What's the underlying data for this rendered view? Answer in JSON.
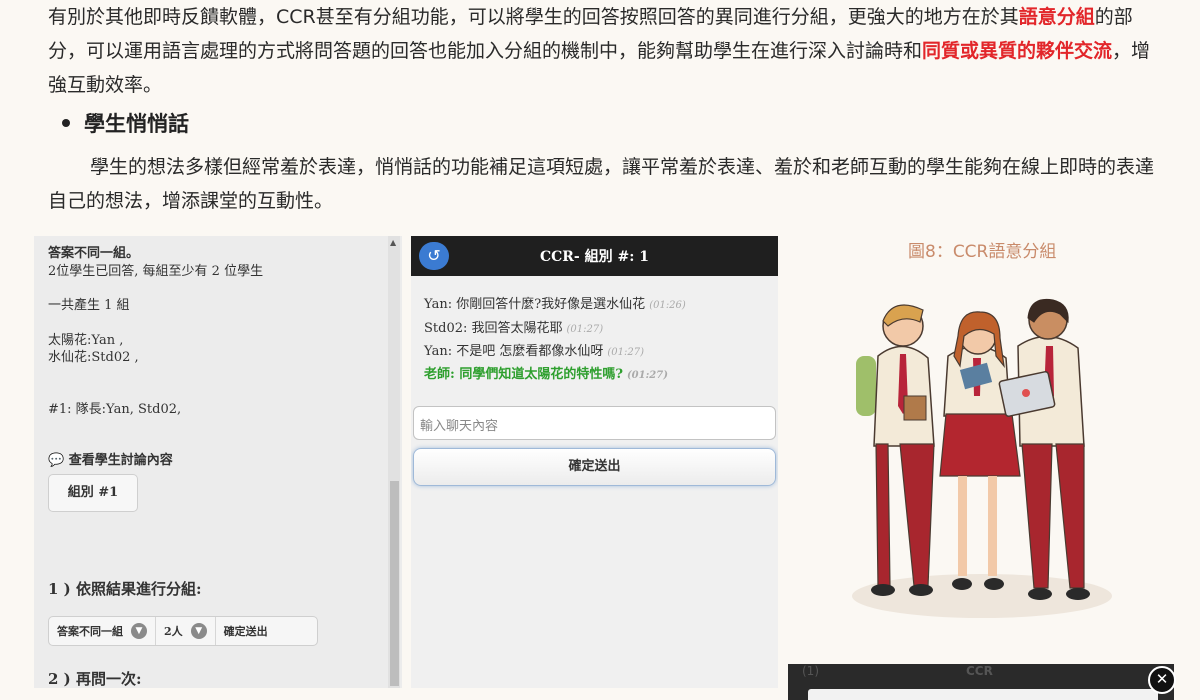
{
  "article": {
    "p1_a": "有別於其他即時反饋軟體，CCR甚至有分組功能，可以將學生的回答按照回答的異同進行分組，更強大的地方在於其",
    "p1_hl1": "語意分組",
    "p1_b": "的部分，可以運用語言處理的方式將問答題的回答也能加入分組的機制中，能夠幫助學生在進行深入討論時和",
    "p1_hl2": "同質或異質的夥伴交流",
    "p1_c": "，增強互動效率。",
    "bullet_heading": "學生悄悄話",
    "p2": "學生的想法多樣但經常羞於表達，悄悄話的功能補足這項短處，讓平常羞於表達、羞於和老師互動的學生能夠在線上即時的表達自己的想法，增添課堂的互動性。"
  },
  "left_panel": {
    "line1": "答案不同一組。",
    "line2": "2位學生已回答, 每組至少有 2 位學生",
    "line3": "一共產生 1 組",
    "line4": "太陽花:Yan ,",
    "line5": "水仙花:Std02 ,",
    "line6": "#1: 隊長:Yan, Std02,",
    "view_discussion": "查看學生討論內容",
    "group_button": "組別 #1",
    "step1": "1 ) 依照結果進行分組:",
    "select_mode": "答案不同一組",
    "select_count": "2人",
    "confirm": "確定送出",
    "step2": "2 ) 再問一次:"
  },
  "chat": {
    "title": "CCR- 組別 #: 1",
    "messages": [
      {
        "text": "Yan: 你剛回答什麼?我好像是選水仙花",
        "time": "(01:26)"
      },
      {
        "text": "Std02: 我回答太陽花耶",
        "time": "(01:27)"
      },
      {
        "text": "Yan: 不是吧 怎麼看都像水仙呀",
        "time": "(01:27)"
      },
      {
        "text": "老師: 同學們知道太陽花的特性嗎?",
        "time": "(01:27)"
      }
    ],
    "input_placeholder": "輸入聊天內容",
    "send_label": "確定送出"
  },
  "figure_caption": "圖8：CCR語意分組",
  "bottom_shot": {
    "left_text": "(1)",
    "title": "CCR"
  },
  "colors": {
    "highlight": "#e2262a",
    "caption": "#c98b6b",
    "teacher_msg": "#2e9f2e",
    "back_button": "#3b7bd2"
  }
}
